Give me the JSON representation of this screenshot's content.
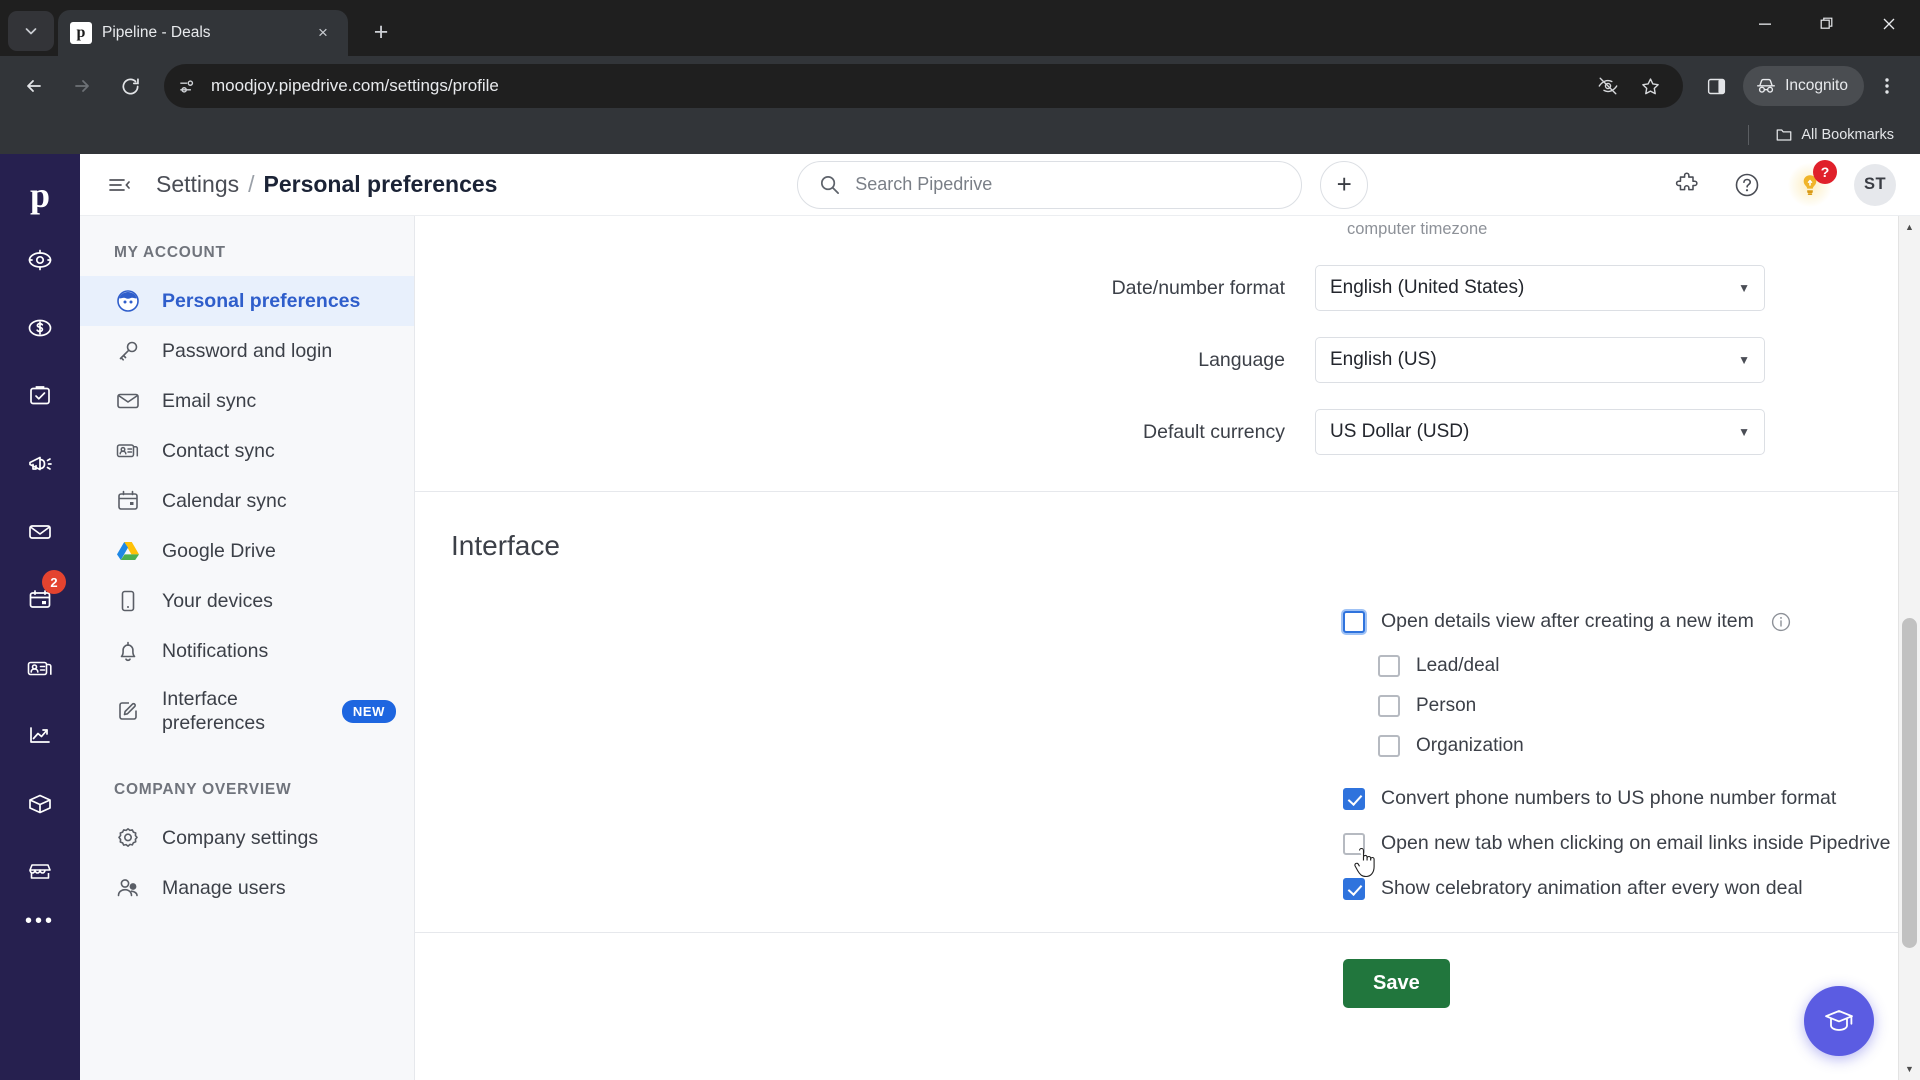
{
  "browser": {
    "tab": {
      "title": "Pipeline - Deals",
      "favicon_letter": "p",
      "close_label": "×"
    },
    "new_tab_label": "+",
    "tab_list_icon": "chevron-down-icon",
    "window": {
      "minimize": "–",
      "maximize": "❐",
      "close": "×"
    },
    "url": "moodjoy.pipedrive.com/settings/profile",
    "nav": {
      "back": "←",
      "forward": "→",
      "reload": "↻"
    },
    "omnibox_icons": [
      "site-settings-icon",
      "tracking-protection-off-icon",
      "bookmark-star-icon"
    ],
    "toolbar_icons": [
      "extensions-puzzle-icon",
      "side-panel-icon",
      "browser-menu-icon"
    ],
    "incognito_label": "Incognito",
    "bookmarks_label": "All Bookmarks"
  },
  "rail": {
    "logo": "p",
    "items": [
      {
        "name": "leads-icon",
        "badge": ""
      },
      {
        "name": "deals-icon",
        "badge": ""
      },
      {
        "name": "activities-icon",
        "badge": ""
      },
      {
        "name": "campaigns-icon",
        "badge": ""
      },
      {
        "name": "mail-icon",
        "badge": ""
      },
      {
        "name": "calendar-icon",
        "badge": "2"
      },
      {
        "name": "contacts-icon",
        "badge": ""
      },
      {
        "name": "insights-icon",
        "badge": ""
      },
      {
        "name": "products-icon",
        "badge": ""
      },
      {
        "name": "marketplace-icon",
        "badge": ""
      }
    ],
    "more_label": "•••"
  },
  "header": {
    "menu_icon": "collapse-sidebar-icon",
    "breadcrumb_root": "Settings",
    "breadcrumb_sep": "/",
    "breadcrumb_current": "Personal preferences",
    "search_placeholder": "Search Pipedrive",
    "add_label": "+",
    "help_badge": "?",
    "avatar_initials": "ST"
  },
  "sidebar": {
    "section_my_account": "MY ACCOUNT",
    "section_company": "COMPANY OVERVIEW",
    "my_account_items": [
      {
        "label": "Personal preferences",
        "icon": "user-avatar-icon",
        "active": true,
        "badge": ""
      },
      {
        "label": "Password and login",
        "icon": "key-icon",
        "active": false,
        "badge": ""
      },
      {
        "label": "Email sync",
        "icon": "envelope-icon",
        "active": false,
        "badge": ""
      },
      {
        "label": "Contact sync",
        "icon": "contact-card-icon",
        "active": false,
        "badge": ""
      },
      {
        "label": "Calendar sync",
        "icon": "calendar-icon",
        "active": false,
        "badge": ""
      },
      {
        "label": "Google Drive",
        "icon": "google-drive-icon",
        "active": false,
        "badge": ""
      },
      {
        "label": "Your devices",
        "icon": "mobile-device-icon",
        "active": false,
        "badge": ""
      },
      {
        "label": "Notifications",
        "icon": "bell-icon",
        "active": false,
        "badge": ""
      },
      {
        "label": "Interface preferences",
        "icon": "interface-edit-icon",
        "active": false,
        "badge": "NEW"
      }
    ],
    "company_items": [
      {
        "label": "Company settings",
        "icon": "gear-icon"
      },
      {
        "label": "Manage users",
        "icon": "users-icon"
      }
    ]
  },
  "main": {
    "timezone_hint": "computer timezone",
    "fields": [
      {
        "label": "Date/number format",
        "value": "English (United States)"
      },
      {
        "label": "Language",
        "value": "English (US)"
      },
      {
        "label": "Default currency",
        "value": "US Dollar (USD)"
      }
    ],
    "interface_title": "Interface",
    "parent_check": {
      "label": "Open details view after creating a new item",
      "checked": false,
      "focused": true,
      "info_icon": "info-circle-icon"
    },
    "sub_checks": [
      {
        "label": "Lead/deal",
        "checked": false
      },
      {
        "label": "Person",
        "checked": false
      },
      {
        "label": "Organization",
        "checked": false
      }
    ],
    "other_checks": [
      {
        "label": "Convert phone numbers to US phone number format",
        "checked": true
      },
      {
        "label": "Open new tab when clicking on email links inside Pipedrive",
        "checked": false
      },
      {
        "label": "Show celebratory animation after every won deal",
        "checked": true
      }
    ],
    "save_label": "Save",
    "fab_icon": "academy-graduation-cap-icon"
  },
  "colors": {
    "rail_navy": "#26204f",
    "active_nav_bg": "#e8f0fc",
    "active_nav_text": "#2f5ecb",
    "checkbox_blue": "#2f73dd",
    "save_green": "#21763d",
    "badge_new_blue": "#1e66e0",
    "fab_purple": "#5b5ce2",
    "rail_badge_red": "#e4432f"
  }
}
